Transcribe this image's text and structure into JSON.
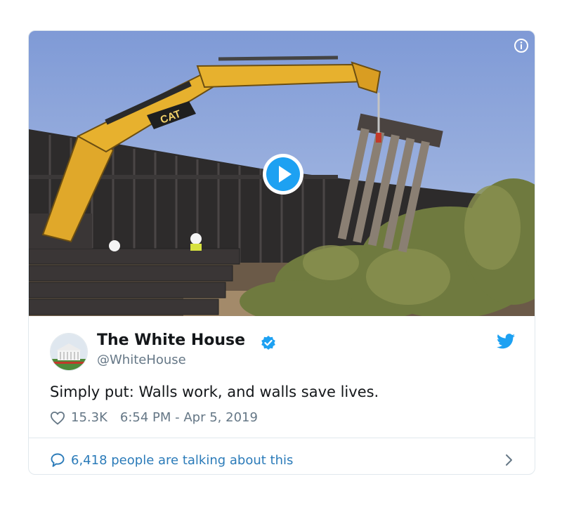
{
  "tweet": {
    "author_name": "The White House",
    "author_handle": "@WhiteHouse",
    "text": "Simply put: Walls work, and walls save lives.",
    "likes": "15.3K",
    "timestamp": "6:54 PM - Apr 5, 2019",
    "conversation_label": "6,418 people are talking about this"
  },
  "media": {
    "brand_mark": "CAT"
  },
  "icons": {
    "info": "info-icon",
    "play": "play-icon",
    "verified": "verified-badge-icon",
    "twitter": "twitter-bird-icon",
    "like": "heart-icon",
    "reply": "comment-bubble-icon",
    "chevron": "chevron-right-icon"
  },
  "colors": {
    "accent": "#1da1f2",
    "link": "#2b7bb9",
    "muted": "#657786",
    "border": "#e1e8ed"
  }
}
